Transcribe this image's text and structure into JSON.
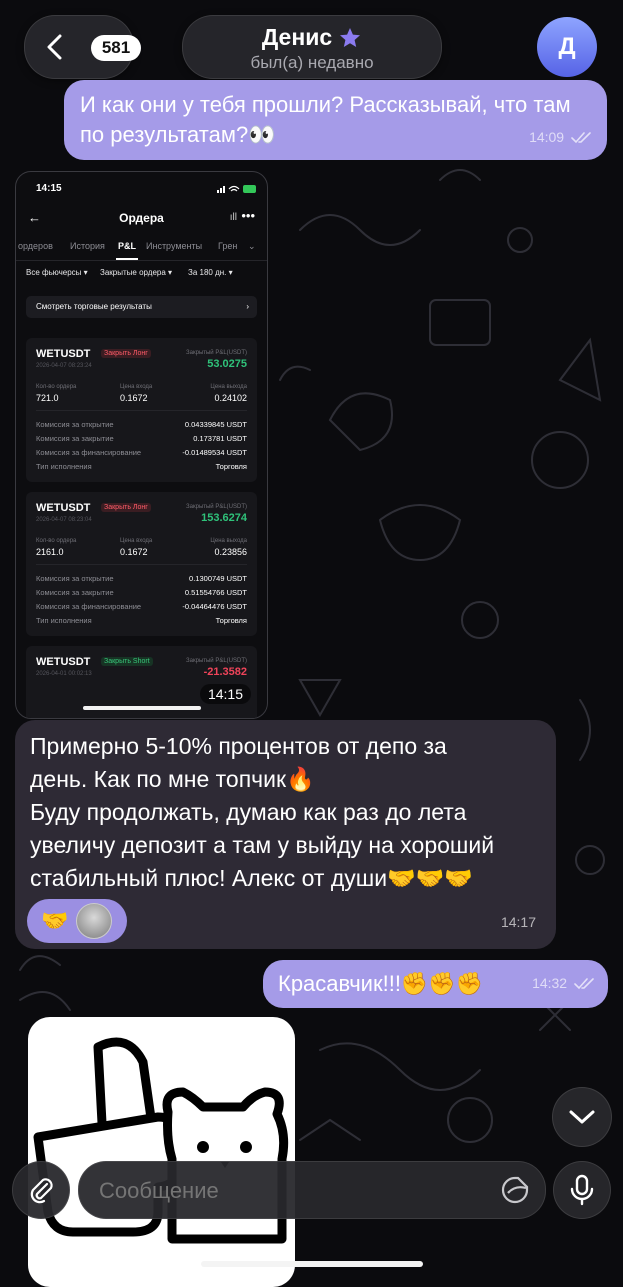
{
  "header": {
    "unread_count": "581",
    "contact_name": "Денис",
    "status": "был(а) недавно",
    "avatar_letter": "Д"
  },
  "messages": {
    "m1": {
      "text": "И как они у тебя прошли? Рассказывай, что там по результатам?👀",
      "time": "14:09"
    },
    "photo": {
      "time": "14:15",
      "screenshot": {
        "clock": "14:15",
        "title": "Ордера",
        "tabs": [
          "ордеров",
          "История",
          "P&L",
          "Инструменты",
          "Грен"
        ],
        "filters": [
          "Все фьючерсы ▾",
          "Закрытые ордера ▾",
          "За 180 дн. ▾"
        ],
        "results_link": "Смотреть торговые результаты",
        "cards": [
          {
            "symbol": "WETUSDT",
            "tag": "Закрыть Лонг",
            "date": "2026-04-07 08:23:24",
            "pnl_label": "Закрытый P&L(USDT)",
            "pnl": "53.0275",
            "qty_label": "Кол-во ордера",
            "qty": "721.0",
            "entry_label": "Цена входа",
            "entry": "0.1672",
            "exit_label": "Цена выхода",
            "exit": "0.24102",
            "rows": [
              {
                "label": "Комиссия за открытие",
                "value": "0.04339845 USDT"
              },
              {
                "label": "Комиссия за закрытие",
                "value": "0.173781 USDT"
              },
              {
                "label": "Комиссия за финансирование",
                "value": "-0.01489534 USDT"
              },
              {
                "label": "Тип исполнения",
                "value": "Торговля"
              }
            ]
          },
          {
            "symbol": "WETUSDT",
            "tag": "Закрыть Лонг",
            "date": "2026-04-07 08:23:04",
            "pnl_label": "Закрытый P&L(USDT)",
            "pnl": "153.6274",
            "qty_label": "Кол-во ордера",
            "qty": "2161.0",
            "entry_label": "Цена входа",
            "entry": "0.1672",
            "exit_label": "Цена выхода",
            "exit": "0.23856",
            "rows": [
              {
                "label": "Комиссия за открытие",
                "value": "0.1300749 USDT"
              },
              {
                "label": "Комиссия за закрытие",
                "value": "0.51554766 USDT"
              },
              {
                "label": "Комиссия за финансирование",
                "value": "-0.04464476 USDT"
              },
              {
                "label": "Тип исполнения",
                "value": "Торговля"
              }
            ]
          },
          {
            "symbol": "WETUSDT",
            "tag": "Закрыть Short",
            "date": "2026-04-01 00:02:13",
            "pnl_label": "Закрытый P&L(USDT)",
            "pnl": "-21.3582"
          }
        ]
      }
    },
    "m2": {
      "lines": [
        "Примерно 5-10% процентов от депо за",
        "день. Как по мне топчик🔥",
        "Буду продолжать, думаю как раз до лета",
        "увеличу депозит а там у выйду на хороший",
        "стабильный плюс! Алекс от души🤝🤝🤝"
      ],
      "time": "14:17",
      "reaction_emoji": "🤝"
    },
    "m3": {
      "text": "Красавчик!!!✊✊✊",
      "time": "14:32"
    }
  },
  "composer": {
    "placeholder": "Сообщение"
  },
  "colors": {
    "outgoing": "#a59be8",
    "incoming": "#2e2a35",
    "accent": "#7b6ee0"
  }
}
